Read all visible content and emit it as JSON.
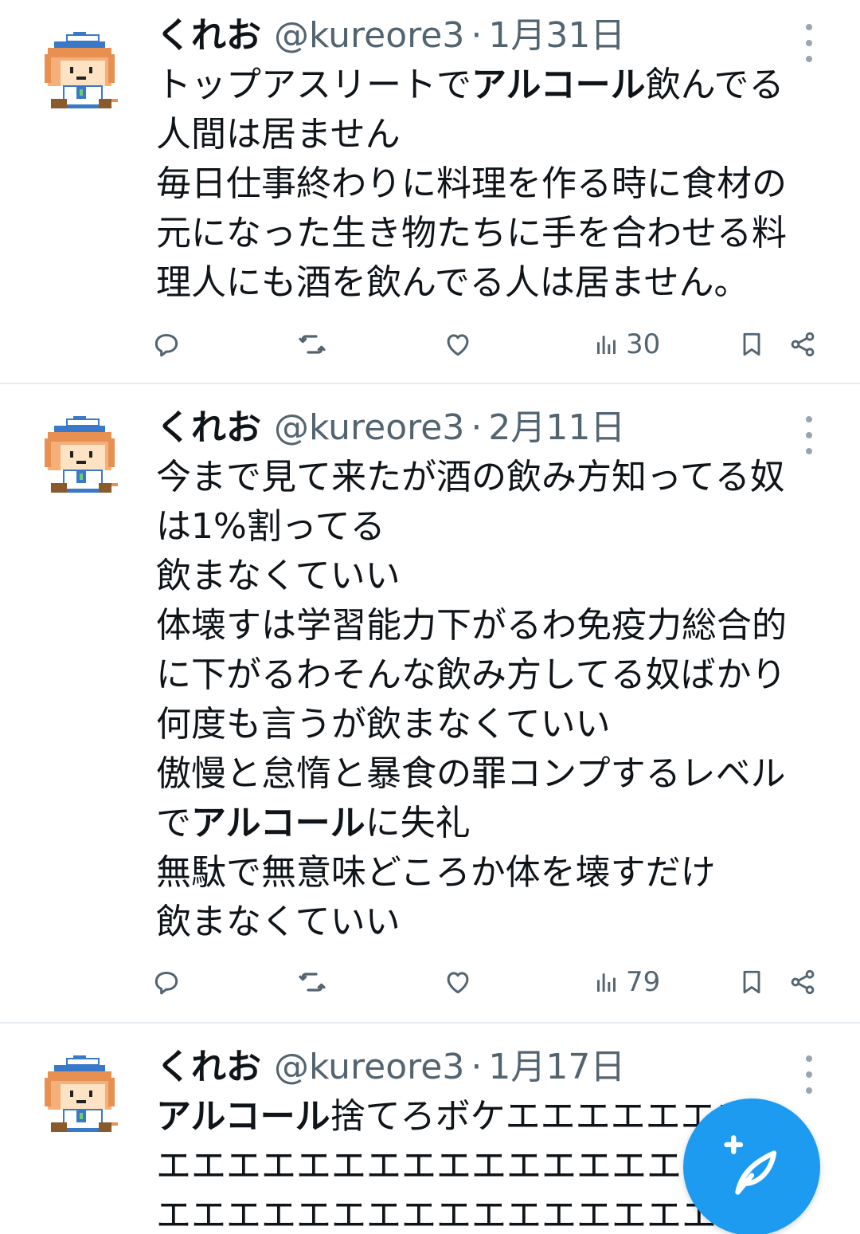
{
  "tweets": [
    {
      "name": "くれお",
      "handle": "@kureore3",
      "dot": "·",
      "date": "1月31日",
      "lines": [
        [
          {
            "t": "トップアスリートで"
          },
          {
            "t": "アルコール",
            "b": true
          },
          {
            "t": "飲んでる"
          }
        ],
        [
          {
            "t": "人間は居ません"
          }
        ],
        [
          {
            "t": "毎日仕事終わりに料理を作る時に食材の"
          }
        ],
        [
          {
            "t": "元になった生き物たちに手を合わせる料"
          }
        ],
        [
          {
            "t": "理人にも酒を飲んでる人は居ません。"
          }
        ]
      ],
      "views": "30"
    },
    {
      "name": "くれお",
      "handle": "@kureore3",
      "dot": "·",
      "date": "2月11日",
      "lines": [
        [
          {
            "t": "今まで見て来たが酒の飲み方知ってる奴"
          }
        ],
        [
          {
            "t": "は1%割ってる"
          }
        ],
        [
          {
            "t": "飲まなくていい"
          }
        ],
        [
          {
            "t": "体壊すは学習能力下がるわ免疫力総合的"
          }
        ],
        [
          {
            "t": "に下がるわそんな飲み方してる奴ばかり"
          }
        ],
        [
          {
            "t": "何度も言うが飲まなくていい"
          }
        ],
        [
          {
            "t": "傲慢と怠惰と暴食の罪コンプするレベル"
          }
        ],
        [
          {
            "t": "で"
          },
          {
            "t": "アルコール",
            "b": true
          },
          {
            "t": "に失礼"
          }
        ],
        [
          {
            "t": "無駄で無意味どころか体を壊すだけ"
          }
        ],
        [
          {
            "t": "飲まなくていい"
          }
        ]
      ],
      "views": "79"
    },
    {
      "name": "くれお",
      "handle": "@kureore3",
      "dot": "·",
      "date": "1月17日",
      "lines": [
        [
          {
            "t": "アルコール",
            "b": true
          },
          {
            "t": "捨てろボケエエエエエエエエ"
          }
        ],
        [
          {
            "t": "エエエエエエエエエエエエエエエエエエ"
          }
        ],
        [
          {
            "t": "エエエエエエエエエエエエエエエエエエ"
          }
        ]
      ]
    }
  ],
  "icons": {
    "reply": "reply-icon",
    "retweet": "retweet-icon",
    "like": "heart-icon",
    "views": "views-chart-icon",
    "bookmark": "bookmark-icon",
    "share": "share-icon",
    "compose": "compose-feather-icon"
  },
  "colors": {
    "accent": "#1d9bf0",
    "text": "#0f1419",
    "secondary": "#536471"
  }
}
